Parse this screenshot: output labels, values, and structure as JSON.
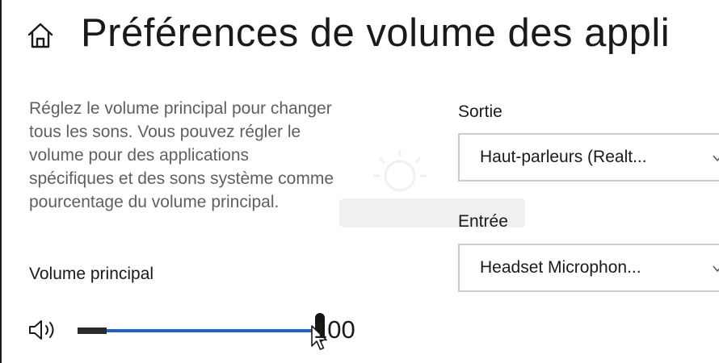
{
  "header": {
    "title": "Préférences de volume des appli",
    "icon": "home-icon"
  },
  "description": {
    "lines": [
      "Réglez le volume principal pour changer",
      "tous les sons. Vous pouvez régler le",
      "volume pour des applications",
      "spécifiques et des sons système comme",
      "pourcentage du volume principal."
    ]
  },
  "volume": {
    "label": "Volume principal",
    "value_text": "100",
    "value": 100,
    "icon": "speaker-icon",
    "accent_color": "#1e63c9"
  },
  "output": {
    "label": "Sortie",
    "selected": "Haut-parleurs (Realt..."
  },
  "input": {
    "label": "Entrée",
    "selected": "Headset Microphon..."
  }
}
